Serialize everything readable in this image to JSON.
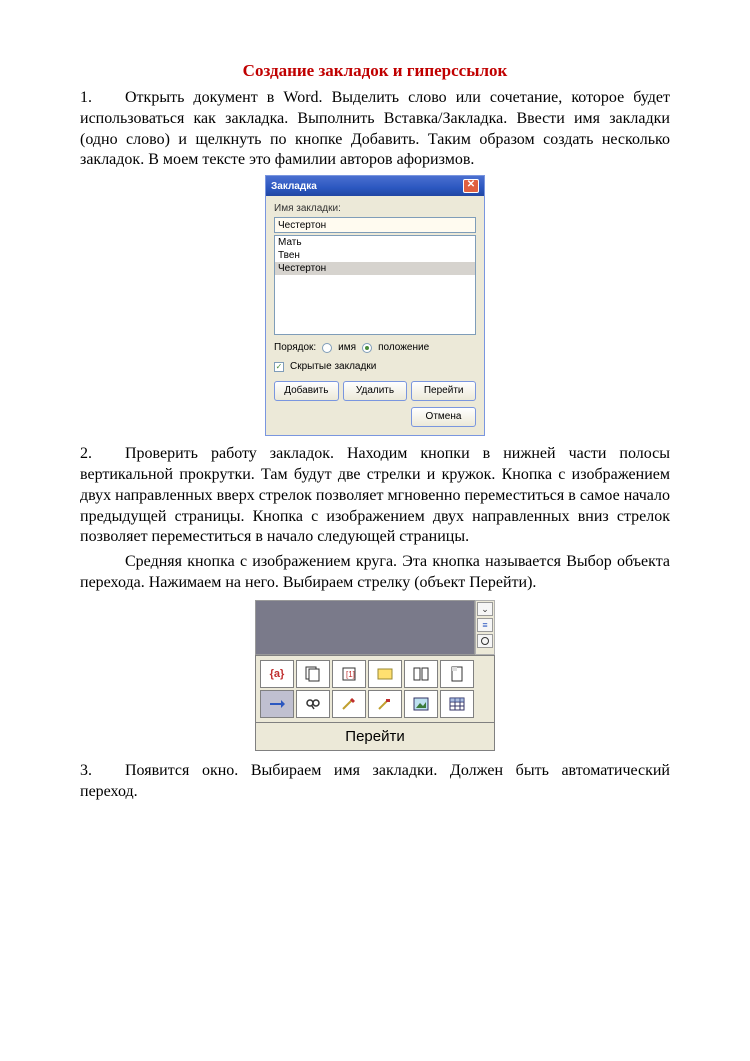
{
  "title": "Создание закладок и гиперссылок",
  "steps": {
    "s1_num": "1.",
    "s1_text": "Открыть документ в Word. Выделить слово или сочетание, которое будет использоваться как закладка. Выполнить Вставка/Закладка. Ввести имя закладки (одно слово) и щелкнуть по кнопке Добавить. Таким образом создать несколько закладок. В моем тексте это фамилии авторов афоризмов.",
    "s2_num": "2.",
    "s2_text": "Проверить работу закладок. Находим кнопки в нижней части полосы вертикальной прокрутки. Там будут две стрелки и кружок. Кнопка с изображением двух направленных вверх стрелок позволяет мгновенно переместиться в самое начало предыдущей страницы. Кнопка с изображением двух направленных вниз стрелок позволяет переместиться в начало следующей страницы.",
    "s2_extra": "Средняя кнопка с изображением круга. Эта кнопка называется Выбор объекта перехода. Нажимаем на него. Выбираем стрелку (объект Перейти).",
    "s3_num": "3.",
    "s3_text": "Появится окно. Выбираем имя закладки. Должен быть автоматический переход."
  },
  "dialog": {
    "title": "Закладка",
    "name_label": "Имя закладки:",
    "name_value": "Честертон",
    "items": [
      "Мать",
      "Твен",
      "Честертон"
    ],
    "order_label": "Порядок:",
    "radio_name": "имя",
    "radio_pos": "положение",
    "hidden_label": "Скрытые закладки",
    "btn_add": "Добавить",
    "btn_del": "Удалить",
    "btn_go": "Перейти",
    "btn_cancel": "Отмена"
  },
  "browse": {
    "row1": [
      "{a}",
      "pages-icon",
      "page-brackets-icon",
      "note-icon",
      "section-icon",
      "page-up-icon"
    ],
    "row2": [
      "arrow-right-icon",
      "binoculars-icon",
      "pencil-icon",
      "edit-icon",
      "picture-icon",
      "table-icon"
    ],
    "label": "Перейти",
    "cell_a": "{a}"
  }
}
